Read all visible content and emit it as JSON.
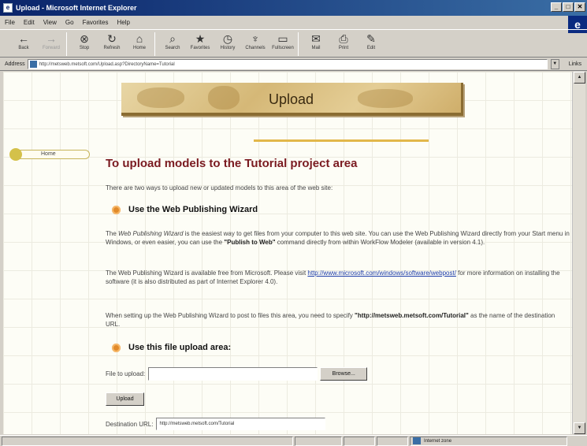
{
  "window": {
    "title": "Upload - Microsoft Internet Explorer",
    "controls": [
      "_",
      "□",
      "✕"
    ]
  },
  "menu": [
    "File",
    "Edit",
    "View",
    "Go",
    "Favorites",
    "Help"
  ],
  "toolbar": {
    "buttons": [
      {
        "label": "Back",
        "icon": "←"
      },
      {
        "label": "Forward",
        "icon": "→"
      },
      {
        "label": "Stop",
        "icon": "⊗"
      },
      {
        "label": "Refresh",
        "icon": "↻"
      },
      {
        "label": "Home",
        "icon": "⌂"
      },
      {
        "label": "Search",
        "icon": "⌕"
      },
      {
        "label": "Favorites",
        "icon": "★"
      },
      {
        "label": "History",
        "icon": "◷"
      },
      {
        "label": "Channels",
        "icon": "♆"
      },
      {
        "label": "Fullscreen",
        "icon": "▭"
      },
      {
        "label": "Mail",
        "icon": "✉"
      },
      {
        "label": "Print",
        "icon": "⎙"
      },
      {
        "label": "Edit",
        "icon": "✎"
      }
    ]
  },
  "address": {
    "label": "Address",
    "url": "http://metsweb.metsoft.com/Upload.asp?DirectoryName=Tutorial",
    "links_label": "Links"
  },
  "page": {
    "banner_title": "Upload",
    "nav_home": "Home",
    "heading": "To upload models to the Tutorial project area",
    "intro": "There are two ways to upload new or updated models to this area of the web site:",
    "section1_title": "Use the Web Publishing Wizard",
    "p1_a": "The ",
    "p1_wizard": "Web Publishing Wizard",
    "p1_b": " is the easiest way to get files from your computer to this web site. You can use the Web Publishing Wizard directly from your Start menu in Windows, or even easier, you can use the ",
    "p1_cmd": "\"Publish to Web\"",
    "p1_c": " command directly from within WorkFlow Modeler (available in version 4.1).",
    "p2_a": "The Web Publishing Wizard is available free from Microsoft. Please visit ",
    "p2_link": "http://www.microsoft.com/windows/software/webpost/",
    "p2_b": " for more information on installing the software (it is also distributed as part of Internet Explorer 4.0).",
    "p3_a": "When setting up the Web Publishing Wizard to post to files this area, you need to specify ",
    "p3_url": "\"http://metsweb.metsoft.com/Tutorial\"",
    "p3_b": " as the name of the destination URL.",
    "section2_title": "Use this file upload area:",
    "file_label": "File to upload:",
    "file_value": "",
    "browse_label": "Browse...",
    "upload_label": "Upload",
    "dest_label": "Destination URL:",
    "dest_value": "http://metsweb.metsoft.com/Tutorial"
  },
  "status": {
    "zone": "Internet zone"
  },
  "colors": {
    "heading": "#7a1a20",
    "link": "#1a3aa8",
    "bullet": "#e18a2a",
    "banner": "#d5b877"
  }
}
